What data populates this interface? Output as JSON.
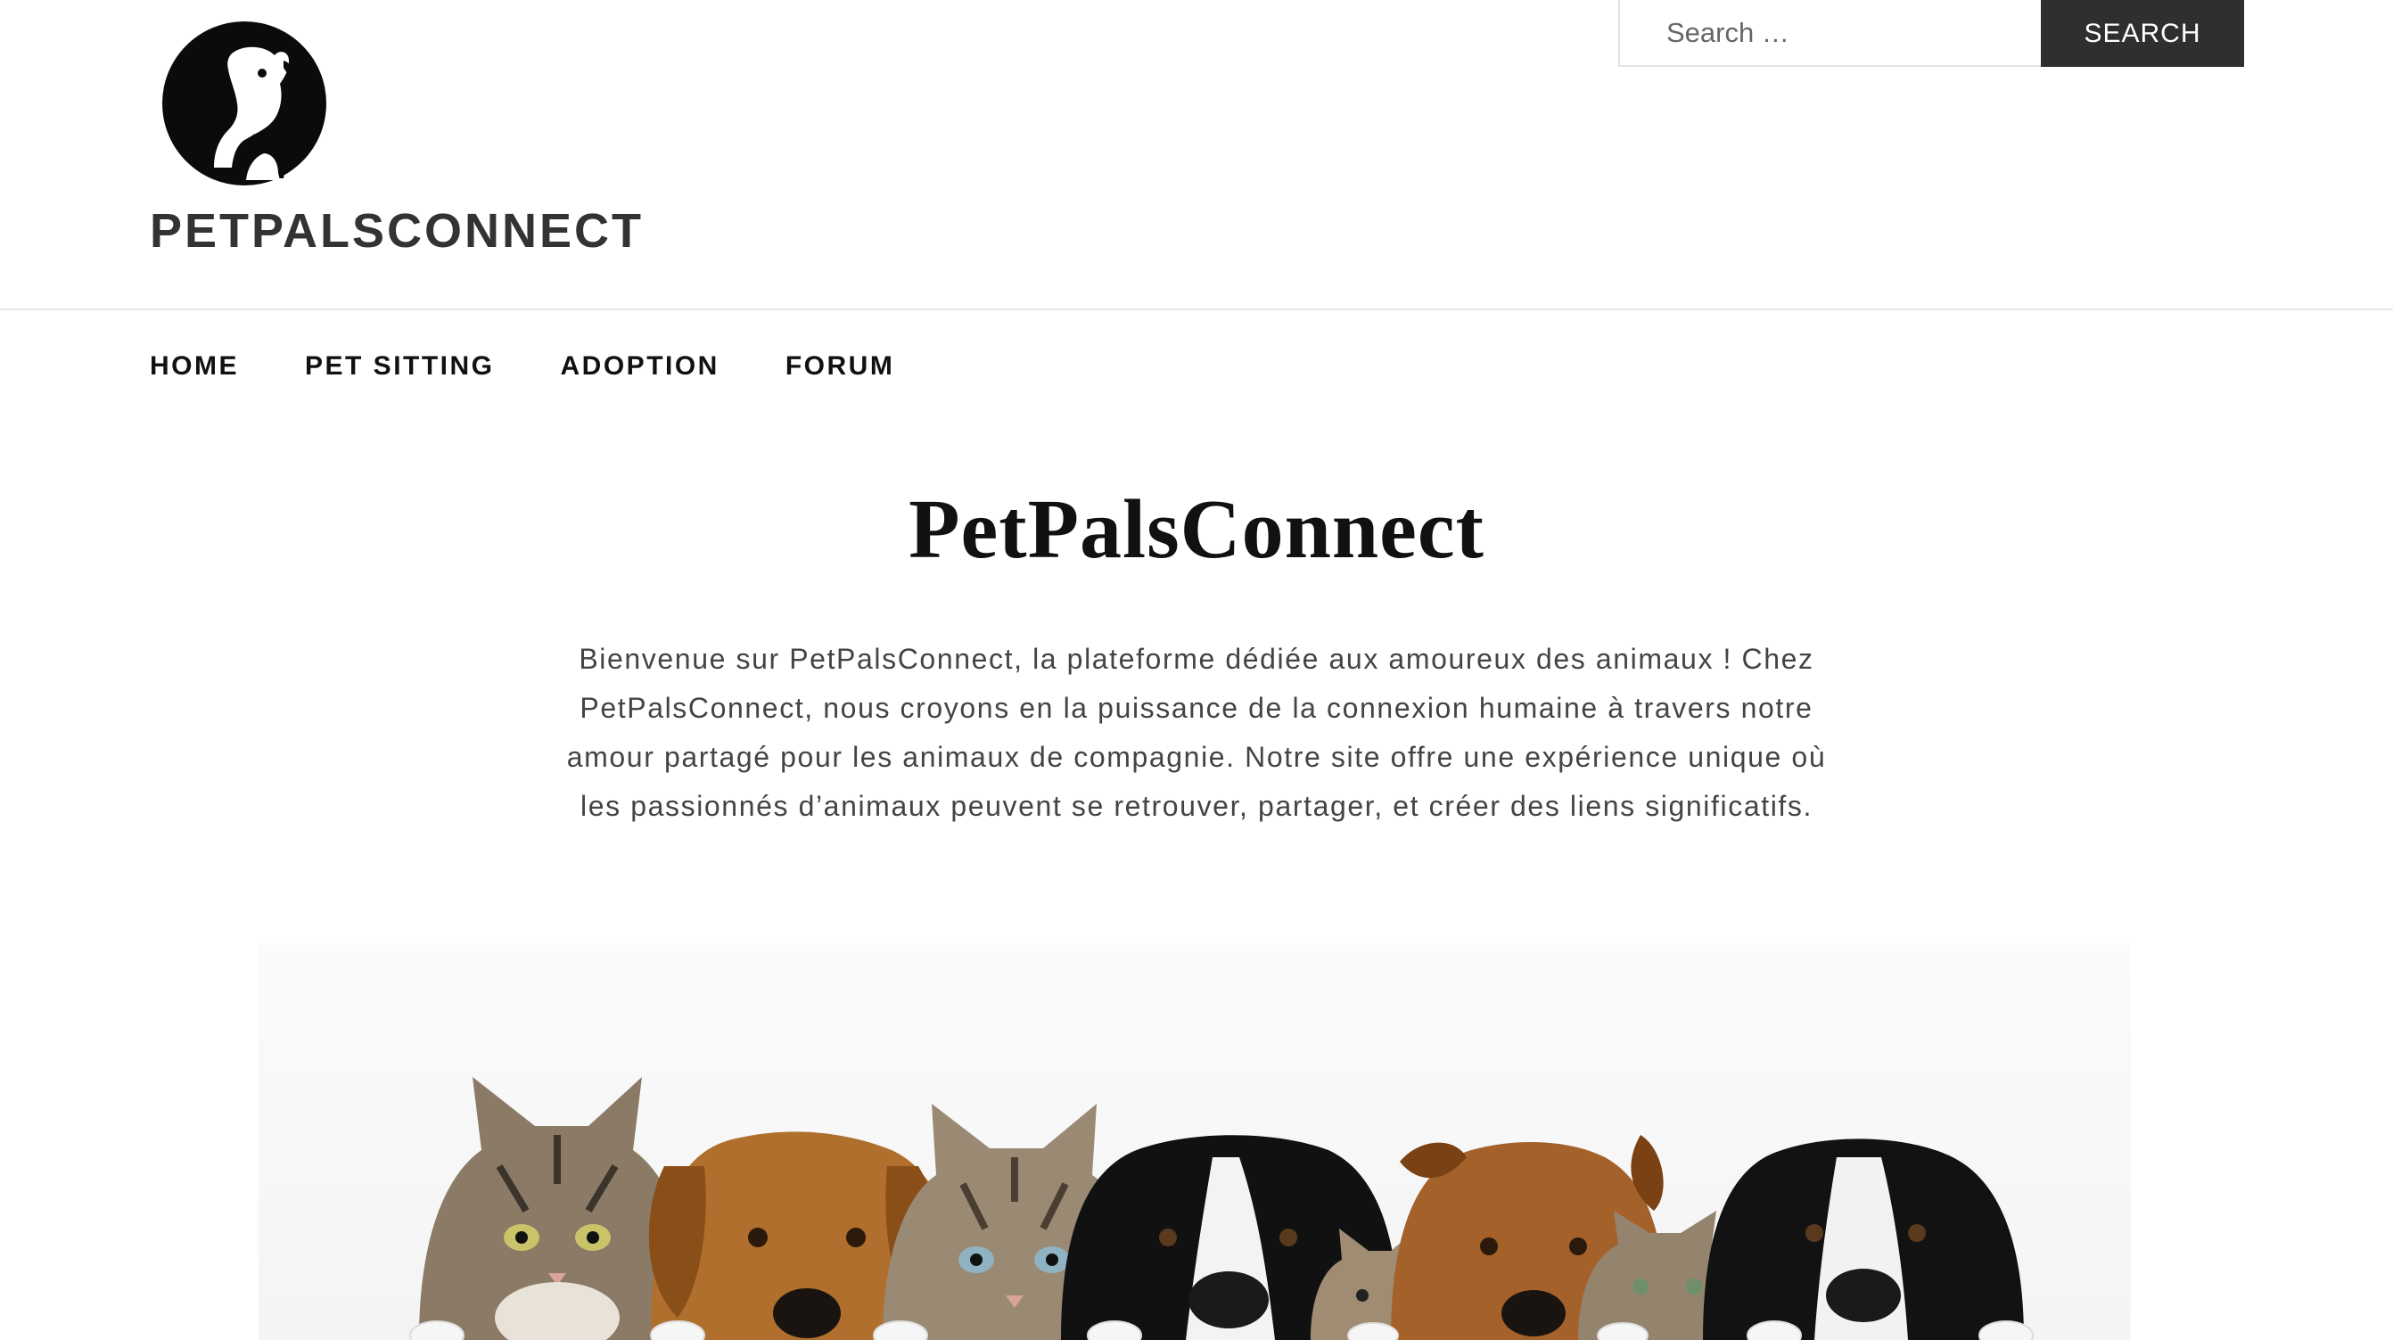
{
  "header": {
    "logo_icon": "dog-cat-silhouette-logo",
    "site_title": "PETPALSCONNECT"
  },
  "search": {
    "placeholder": "Search …",
    "button_label": "SEARCH"
  },
  "nav": {
    "items": [
      {
        "label": "HOME"
      },
      {
        "label": "PET SITTING"
      },
      {
        "label": "ADOPTION"
      },
      {
        "label": "FORUM"
      }
    ]
  },
  "main": {
    "heading": "PetPalsConnect",
    "intro": "Bienvenue sur PetPalsConnect, la plateforme dédiée aux amoureux des animaux ! Chez PetPalsConnect, nous croyons en la puissance de la connexion humaine à travers notre amour partagé pour les animaux de compagnie. Notre site offre une expérience unique où les passionnés d’animaux peuvent se retrouver, partager, et créer des liens significatifs.",
    "hero_image": "row-of-cats-and-dogs-photo"
  },
  "colors": {
    "search_button_bg": "#2f2f2f",
    "text_dark": "#111111",
    "text_body": "#444444",
    "border": "#e2e2e2"
  }
}
